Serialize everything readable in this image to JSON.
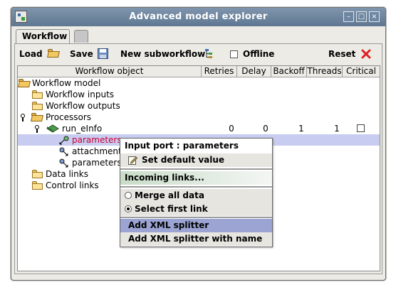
{
  "window": {
    "title": "Advanced model explorer",
    "controls": [
      "minimize",
      "maximize",
      "close"
    ]
  },
  "tabs": [
    {
      "label": "Workflow",
      "active": true
    },
    {
      "label": "",
      "active": false
    }
  ],
  "toolbar": {
    "load_label": "Load",
    "save_label": "Save",
    "new_subworkflow_label": "New subworkflow",
    "offline_label": "Offline",
    "offline_checked": false,
    "reset_label": "Reset"
  },
  "columns": [
    "Workflow object",
    "Retries",
    "Delay",
    "Backoff",
    "Threads",
    "Critical"
  ],
  "tree": {
    "root": "Workflow model",
    "workflow_inputs": "Workflow inputs",
    "workflow_outputs": "Workflow outputs",
    "processors": "Processors",
    "processor": {
      "name": "run_eInfo",
      "retries": "0",
      "delay": "0",
      "backoff": "1",
      "threads": "1",
      "critical": false
    },
    "ports": [
      "parameters",
      "attachmentL",
      "parameters"
    ],
    "data_links": "Data links",
    "control_links": "Control links"
  },
  "context_menu": {
    "header": "Input port : parameters",
    "set_default": "Set default value",
    "incoming_links": "Incoming links...",
    "merge_all": "Merge all data",
    "select_first": "Select first link",
    "selected_option": "select_first",
    "add_xml_splitter": "Add XML splitter",
    "add_xml_splitter_named": "Add XML splitter with name"
  },
  "colors": {
    "titlebar": "#6f86a0",
    "selection": "#c8ccf0",
    "menu_highlight": "#9ba4d2",
    "port_text_selected": "#cc0033",
    "reset_icon": "#dd2222"
  }
}
